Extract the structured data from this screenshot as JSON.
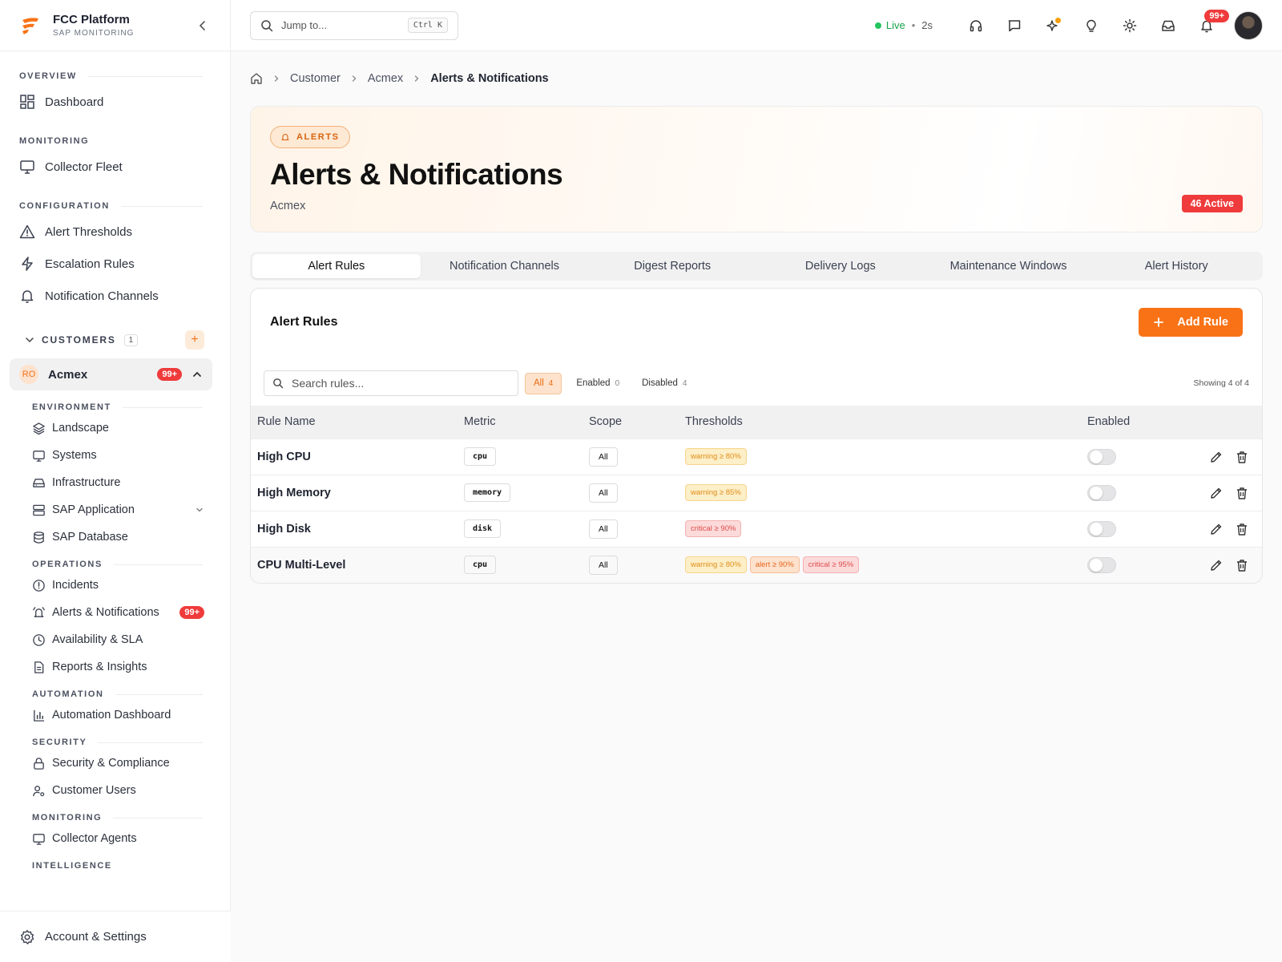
{
  "brand": {
    "title": "FCC Platform",
    "subtitle": "SAP MONITORING",
    "color": "#f97316"
  },
  "sidebar": {
    "sections": {
      "overview": "OVERVIEW",
      "monitoring": "MONITORING",
      "configuration": "CONFIGURATION"
    },
    "items": {
      "dashboard": "Dashboard",
      "collector_fleet": "Collector Fleet",
      "alert_thresholds": "Alert Thresholds",
      "escalation_rules": "Escalation Rules",
      "notification_channels": "Notification Channels"
    },
    "customers": {
      "label": "CUSTOMERS",
      "count": "1",
      "add": "+"
    },
    "customer": {
      "initials": "RO",
      "name": "Acmex",
      "badge": "99+"
    },
    "sub_sections": {
      "environment": "ENVIRONMENT",
      "operations": "OPERATIONS",
      "automation": "AUTOMATION",
      "security": "SECURITY",
      "monitoring": "MONITORING",
      "intelligence": "INTELLIGENCE"
    },
    "sub_items": {
      "landscape": "Landscape",
      "systems": "Systems",
      "infrastructure": "Infrastructure",
      "sap_application": "SAP Application",
      "sap_database": "SAP Database",
      "incidents": "Incidents",
      "alerts_notifications": "Alerts & Notifications",
      "alerts_badge": "99+",
      "availability_sla": "Availability & SLA",
      "reports_insights": "Reports & Insights",
      "automation_dashboard": "Automation Dashboard",
      "security_compliance": "Security & Compliance",
      "customer_users": "Customer Users",
      "collector_agents": "Collector Agents"
    },
    "footer": "Account & Settings"
  },
  "topbar": {
    "search_placeholder": "Jump to...",
    "shortcut": "Ctrl K",
    "live_label": "Live",
    "live_sep": "•",
    "live_interval": "2s",
    "notif_badge": "99+"
  },
  "breadcrumb": [
    "Customer",
    "Acmex",
    "Alerts & Notifications"
  ],
  "hero": {
    "pill": "ALERTS",
    "title": "Alerts & Notifications",
    "subtitle": "Acmex",
    "active_badge": "46 Active"
  },
  "tabs": [
    "Alert Rules",
    "Notification Channels",
    "Digest Reports",
    "Delivery Logs",
    "Maintenance Windows",
    "Alert History"
  ],
  "panel": {
    "title": "Alert Rules",
    "add_button": "Add Rule",
    "search_placeholder": "Search rules...",
    "filters": [
      {
        "label": "All",
        "count": "4"
      },
      {
        "label": "Enabled",
        "count": "0"
      },
      {
        "label": "Disabled",
        "count": "4"
      }
    ],
    "showing": "Showing 4 of 4"
  },
  "table": {
    "columns": [
      "Rule Name",
      "Metric",
      "Scope",
      "Thresholds",
      "Enabled"
    ],
    "rows": [
      {
        "name": "High CPU",
        "metric": "cpu",
        "scope": "All",
        "thresholds": [
          {
            "level": "warn",
            "text": "warning ≥ 80%"
          }
        ],
        "enabled": false
      },
      {
        "name": "High Memory",
        "metric": "memory",
        "scope": "All",
        "thresholds": [
          {
            "level": "warn",
            "text": "warning ≥ 85%"
          }
        ],
        "enabled": false
      },
      {
        "name": "High Disk",
        "metric": "disk",
        "scope": "All",
        "thresholds": [
          {
            "level": "crit",
            "text": "critical ≥ 90%"
          }
        ],
        "enabled": false
      },
      {
        "name": "CPU Multi-Level",
        "metric": "cpu",
        "scope": "All",
        "thresholds": [
          {
            "level": "warn",
            "text": "warning ≥ 80%"
          },
          {
            "level": "alert",
            "text": "alert ≥ 90%"
          },
          {
            "level": "crit",
            "text": "critical ≥ 95%"
          }
        ],
        "enabled": false
      }
    ]
  },
  "colors": {
    "accent": "#f97316",
    "danger": "#ef3b3b",
    "live": "#22c55e"
  }
}
